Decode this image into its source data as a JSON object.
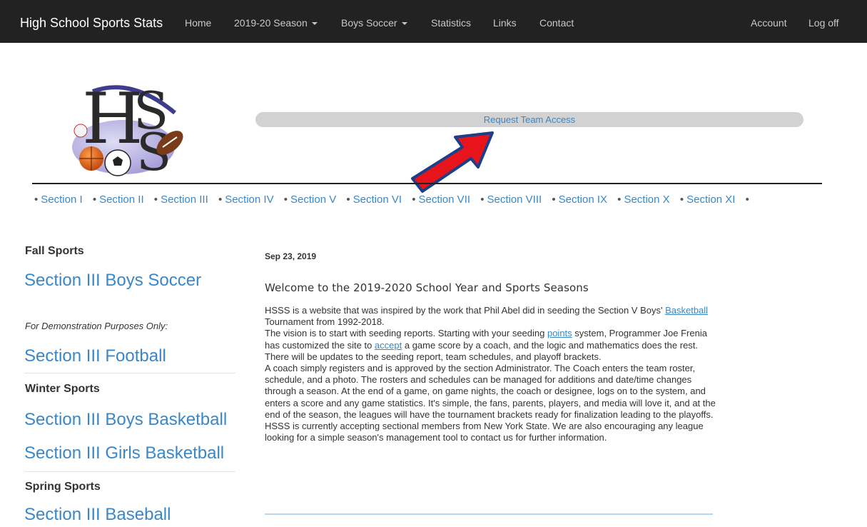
{
  "nav": {
    "brand": "High School Sports Stats",
    "home": "Home",
    "season": "2019-20 Season",
    "sport": "Boys Soccer",
    "statistics": "Statistics",
    "links": "Links",
    "contact": "Contact",
    "account": "Account",
    "logoff": "Log off"
  },
  "header": {
    "logo_text": "HSSS",
    "request_access": "Request Team Access"
  },
  "sections": [
    "Section I",
    "Section II",
    "Section III",
    "Section IV",
    "Section V",
    "Section VI",
    "Section VII",
    "Section VIII",
    "Section IX",
    "Section X",
    "Section XI"
  ],
  "sidebar": {
    "fall_heading": "Fall Sports",
    "fall_link": "Section III Boys Soccer",
    "demo_note": "For Demonstration Purposes Only:",
    "football": "Section III Football",
    "winter_heading": "Winter Sports",
    "boys_basketball": "Section III Boys Basketball",
    "girls_basketball": "Section III Girls Basketball",
    "spring_heading": "Spring Sports",
    "baseball": "Section III Baseball"
  },
  "post": {
    "date": "Sep 23, 2019",
    "title": "Welcome to the 2019-2020 School Year and Sports Seasons",
    "p1_before": "HSSS is a website that was inspired by the work that Phil Abel did in seeding the Section V Boys' ",
    "p1_link": "Basketball",
    "p1_after": " Tournament from 1992-2018.",
    "p2_before": "The vision is to start with seeding reports. Starting with your seeding ",
    "p2_link1": "points",
    "p2_mid": " system, Programmer Joe Frenia has customized the site to ",
    "p2_link2": "accept",
    "p2_after": " a game score by a coach, and the logic and mathematics does the rest. There will be updates to the seeding report, team schedules, and playoff brackets.",
    "p3": "A coach simply registers and is approved by the section Administrator. The Coach enters the team roster, schedule, and a photo. The rosters and schedules can be managed for additions and date/time changes through a season. At the end of a game, on game nights, the coach or designee, logs on to the system, and enters a score and any game statistics. It's simple, the fans, parents, players, and media will love it, and at the end of the season, the leagues will have the tournament brackets ready for finalization leading to the playoffs.",
    "p4": "HSSS is currently accepting sectional members from New York State. We are also encouraging any league looking for a simple season's management tool to contact us for further information."
  },
  "colors": {
    "navbar_bg": "#222222",
    "link": "#3a87c8",
    "arrow_fill": "#e8141b",
    "arrow_outline": "#1c3f8a"
  }
}
